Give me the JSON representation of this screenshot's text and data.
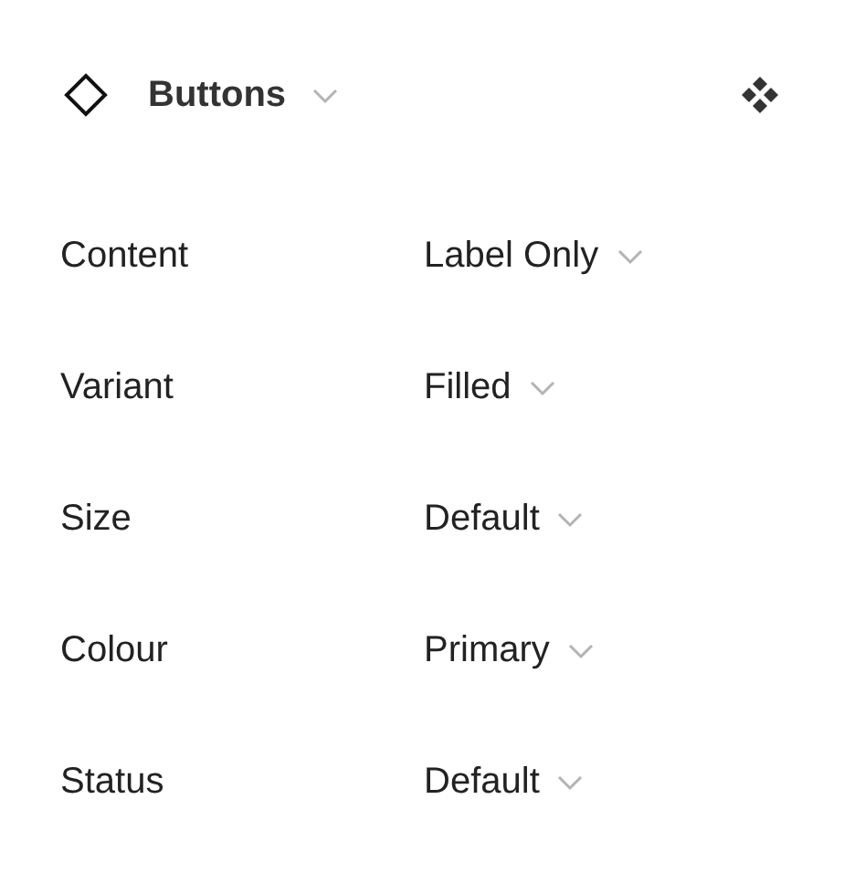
{
  "header": {
    "title": "Buttons"
  },
  "properties": [
    {
      "label": "Content",
      "value": "Label Only"
    },
    {
      "label": "Variant",
      "value": "Filled"
    },
    {
      "label": "Size",
      "value": "Default"
    },
    {
      "label": "Colour",
      "value": "Primary"
    },
    {
      "label": "Status",
      "value": "Default"
    }
  ]
}
